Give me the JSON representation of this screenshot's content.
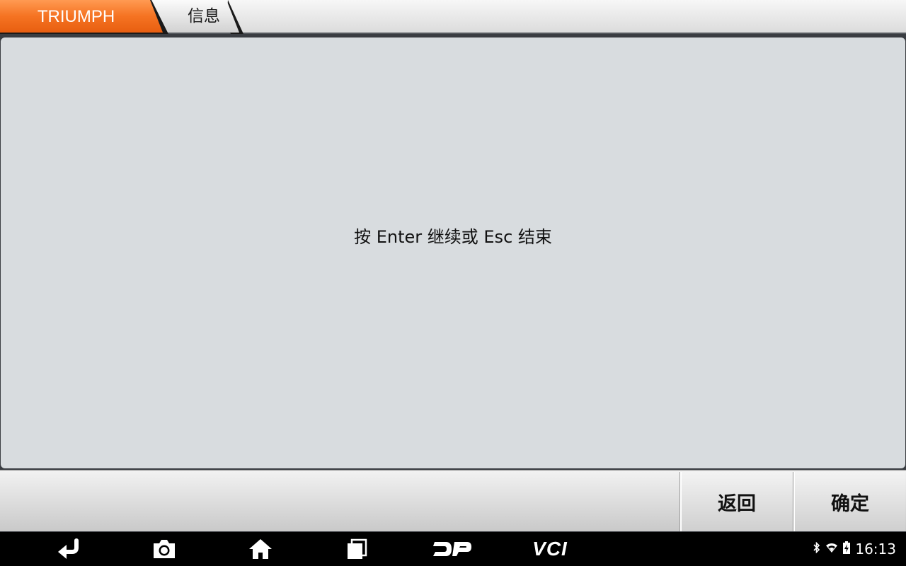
{
  "breadcrumb": {
    "brand": "TRIUMPH",
    "page": "信息"
  },
  "main": {
    "message": "按 Enter 继续或 Esc 结束"
  },
  "actions": {
    "back_label": "返回",
    "confirm_label": "确定"
  },
  "navbar": {
    "icons": [
      "back-icon",
      "camera-icon",
      "home-icon",
      "recent-apps-icon",
      "dp-icon",
      "vci-icon"
    ],
    "vci_label": "VCI"
  },
  "status_bar": {
    "icons": [
      "bluetooth-icon",
      "wifi-icon",
      "battery-icon"
    ],
    "time": "16:13"
  },
  "colors": {
    "brand_orange": "#f26a1b",
    "content_bg": "#d8dcdf",
    "nav_bg": "#000000"
  }
}
